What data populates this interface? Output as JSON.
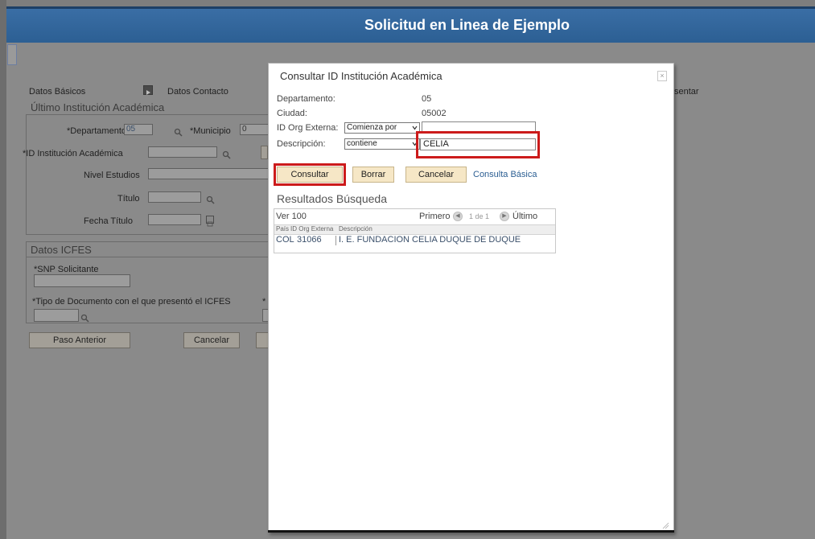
{
  "page": {
    "title": "Solicitud en Linea de Ejemplo"
  },
  "steps": {
    "datos_basicos": "Datos Básicos",
    "datos_contacto": "Datos Contacto",
    "presentar": "sentar"
  },
  "institucion": {
    "section_title": "Último Institución Académica",
    "departamento_label": "*Departamento",
    "departamento_value": "05",
    "municipio_label": "*Municipio",
    "municipio_value": "0",
    "id_institucion_label": "*ID Institución Académica",
    "nivel_estudios_label": "Nivel Estudios",
    "titulo_label": "Título",
    "fecha_titulo_label": "Fecha Título"
  },
  "icfes": {
    "section_title": "Datos ICFES",
    "snp_label": "*SNP Solicitante",
    "tipo_doc_label": "*Tipo de Documento con el que presentó el ICFES",
    "tipo_doc_label2": "*"
  },
  "buttons": {
    "paso_anterior": "Paso Anterior",
    "cancelar": "Cancelar"
  },
  "modal": {
    "title": "Consultar ID Institución Académica",
    "close_symbol": "×",
    "departamento_label": "Departamento:",
    "departamento_value": "05",
    "ciudad_label": "Ciudad:",
    "ciudad_value": "05002",
    "id_org_label": "ID Org Externa:",
    "id_org_operator": "Comienza por",
    "descripcion_label": "Descripción:",
    "descripcion_operator": "contiene",
    "descripcion_value": "CELIA",
    "consultar": "Consultar",
    "borrar": "Borrar",
    "cancelar": "Cancelar",
    "consulta_basica": "Consulta Básica",
    "results_title": "Resultados Búsqueda",
    "ver_100": "Ver 100",
    "primero": "Primero",
    "paging": "1 de 1",
    "ultimo": "Último",
    "columns": [
      "País",
      "ID Org Externa",
      "Descripción"
    ],
    "rows": [
      [
        "COL",
        "31066",
        "I. E. FUNDACION CELIA DUQUE DE DUQUE"
      ]
    ]
  },
  "colors": {
    "header": "#2b5e92",
    "highlight": "#cc1b1b",
    "button_fill": "#f6e7c6",
    "link": "#2b5e92"
  },
  "icons": {
    "lookup": "magnifier-icon",
    "calendar": "calendar-icon",
    "step": "step-arrow-icon",
    "dropdown": "chevron-down-icon",
    "close": "close-icon"
  }
}
